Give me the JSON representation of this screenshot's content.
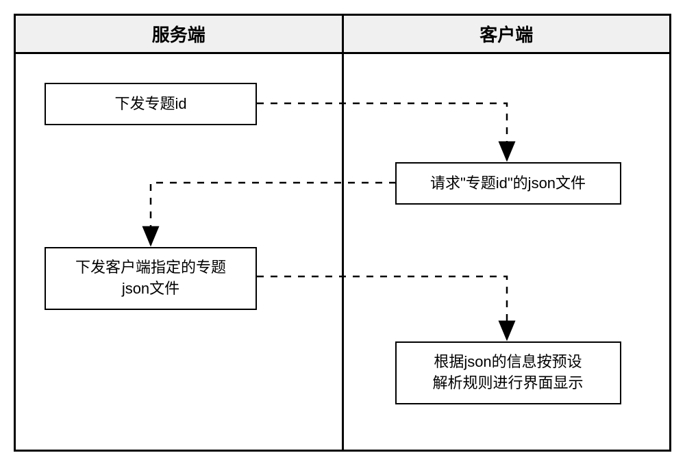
{
  "swimlanes": {
    "server": "服务端",
    "client": "客户端"
  },
  "nodes": {
    "n1": "下发专题id",
    "n2": "请求\"专题id\"的json文件",
    "n3": "下发客户端指定的专题\njson文件",
    "n4": "根据json的信息按预设\n解析规则进行界面显示"
  }
}
